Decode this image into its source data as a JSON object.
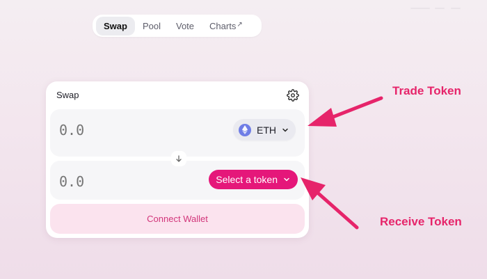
{
  "nav": {
    "items": [
      {
        "label": "Swap",
        "active": true
      },
      {
        "label": "Pool",
        "active": false
      },
      {
        "label": "Vote",
        "active": false
      },
      {
        "label": "Charts",
        "active": false,
        "external": true
      }
    ],
    "external_icon": "arrow-up-right-icon"
  },
  "swap": {
    "title": "Swap",
    "settings_icon": "gear-icon",
    "input": {
      "amount_placeholder": "0.0",
      "token_label": "ETH",
      "token_icon": "ethereum-icon"
    },
    "switch_icon": "arrow-down-icon",
    "output": {
      "amount_placeholder": "0.0",
      "select_label": "Select a token"
    },
    "connect_label": "Connect Wallet"
  },
  "annotations": {
    "trade": "Trade Token",
    "receive": "Receive Token"
  },
  "colors": {
    "accent": "#e5177a",
    "annotation": "#e6246a",
    "connect_bg": "#fbe3ee",
    "eth_icon": "#6f7de6"
  }
}
